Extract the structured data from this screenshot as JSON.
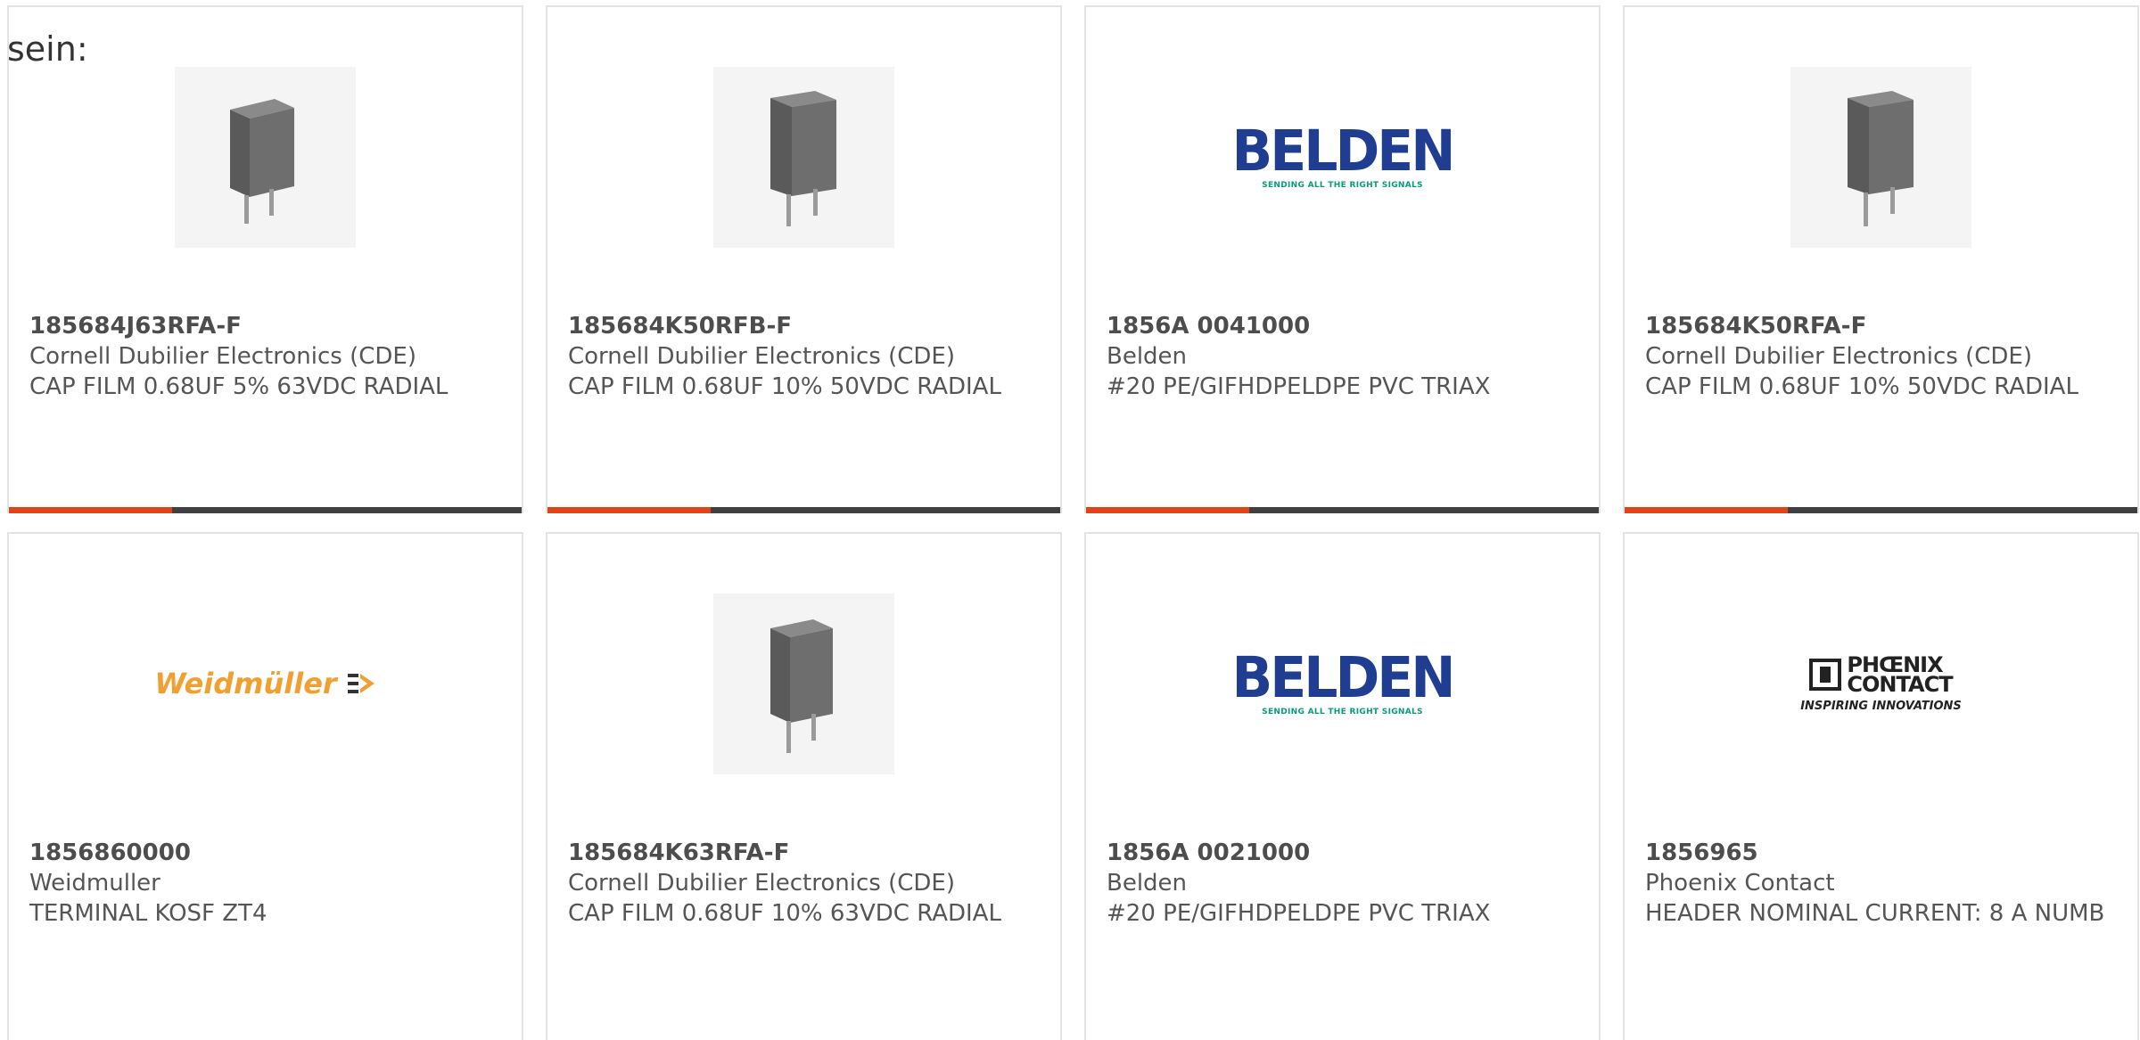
{
  "page": {
    "heading": "sein:"
  },
  "colors": {
    "accent": "#e2441a",
    "bar": "#404040",
    "belden_blue": "#1f3e92",
    "belden_green": "#0a9a7a",
    "weidmuller_orange": "#f0a030"
  },
  "products": [
    {
      "part_number": "185684J63RFA-F",
      "manufacturer": "Cornell Dubilier Electronics (CDE)",
      "description": "CAP FILM 0.68UF 5% 63VDC RADIAL",
      "image_icon": "capacitor-icon"
    },
    {
      "part_number": "185684K50RFB-F",
      "manufacturer": "Cornell Dubilier Electronics (CDE)",
      "description": "CAP FILM 0.68UF 10% 50VDC RADIAL",
      "image_icon": "capacitor-icon"
    },
    {
      "part_number": "1856A 0041000",
      "manufacturer": "Belden",
      "description": "#20 PE/GIFHDPELDPE PVC TRIAX",
      "image_icon": "belden-logo",
      "logo_text": "BELDEN",
      "logo_tagline": "SENDING ALL THE RIGHT SIGNALS"
    },
    {
      "part_number": "185684K50RFA-F",
      "manufacturer": "Cornell Dubilier Electronics (CDE)",
      "description": "CAP FILM 0.68UF 10% 50VDC RADIAL",
      "image_icon": "capacitor-icon"
    },
    {
      "part_number": "1856860000",
      "manufacturer": "Weidmuller",
      "description": "TERMINAL KOSF ZT4",
      "image_icon": "weidmuller-logo",
      "logo_text": "Weidmüller"
    },
    {
      "part_number": "185684K63RFA-F",
      "manufacturer": "Cornell Dubilier Electronics (CDE)",
      "description": "CAP FILM 0.68UF 10% 63VDC RADIAL",
      "image_icon": "capacitor-icon"
    },
    {
      "part_number": "1856A 0021000",
      "manufacturer": "Belden",
      "description": "#20 PE/GIFHDPELDPE PVC TRIAX",
      "image_icon": "belden-logo",
      "logo_text": "BELDEN",
      "logo_tagline": "SENDING ALL THE RIGHT SIGNALS"
    },
    {
      "part_number": "1856965",
      "manufacturer": "Phoenix Contact",
      "description": "HEADER NOMINAL CURRENT: 8 A NUMB",
      "image_icon": "phoenix-contact-logo",
      "logo_line1": "PHŒNIX",
      "logo_line2": "CONTACT",
      "logo_tagline": "INSPIRING INNOVATIONS"
    }
  ]
}
